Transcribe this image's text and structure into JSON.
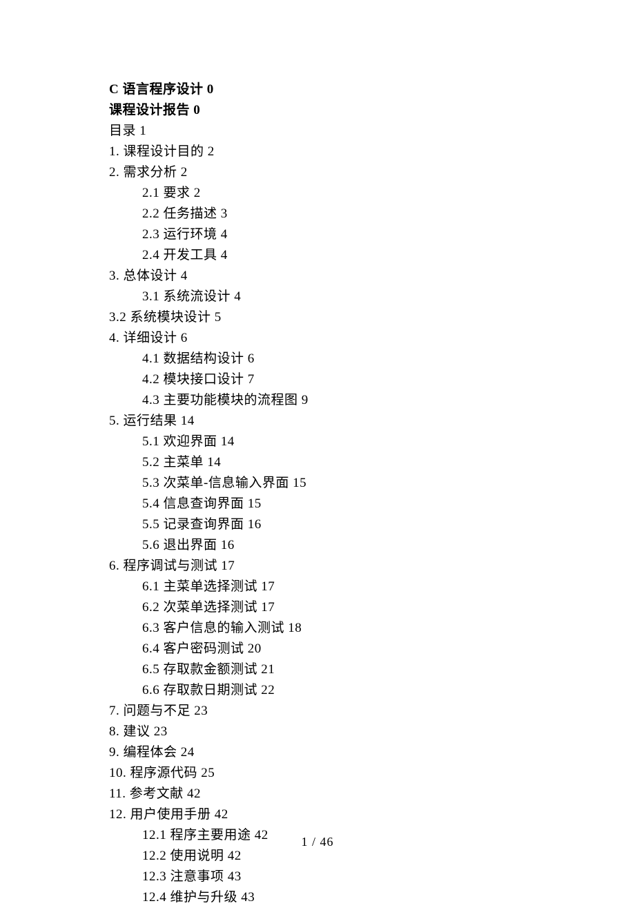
{
  "title1": "C 语言程序设计 0",
  "title2": "课程设计报告 0",
  "toc_label": "目录 1",
  "items": [
    {
      "text": "1. 课程设计目的 2",
      "indent": 0
    },
    {
      "text": "2. 需求分析 2",
      "indent": 0
    },
    {
      "text": "2.1 要求 2",
      "indent": 1
    },
    {
      "text": "2.2 任务描述 3",
      "indent": 1
    },
    {
      "text": "2.3 运行环境 4",
      "indent": 1
    },
    {
      "text": "2.4 开发工具 4",
      "indent": 1
    },
    {
      "text": "3. 总体设计 4",
      "indent": 0
    },
    {
      "text": "3.1 系统流设计 4",
      "indent": 1
    }
  ],
  "item_sys_module": "3.2 系统模块设计 5",
  "items2": [
    {
      "text": "4. 详细设计 6",
      "indent": 0
    },
    {
      "text": "4.1 数据结构设计 6",
      "indent": 1
    },
    {
      "text": "4.2 模块接口设计 7",
      "indent": 1
    },
    {
      "text": "4.3 主要功能模块的流程图 9",
      "indent": 1
    },
    {
      "text": "5. 运行结果 14",
      "indent": 0
    },
    {
      "text": "5.1 欢迎界面 14",
      "indent": 1
    },
    {
      "text": "5.2 主菜单 14",
      "indent": 1
    },
    {
      "text": "5.3 次菜单-信息输入界面 15",
      "indent": 1
    },
    {
      "text": "5.4 信息查询界面 15",
      "indent": 1
    },
    {
      "text": "5.5 记录查询界面 16",
      "indent": 1
    },
    {
      "text": "5.6 退出界面 16",
      "indent": 1
    },
    {
      "text": "6. 程序调试与测试 17",
      "indent": 0
    },
    {
      "text": "6.1 主菜单选择测试 17",
      "indent": 1
    },
    {
      "text": "6.2 次菜单选择测试 17",
      "indent": 1
    },
    {
      "text": "6.3 客户信息的输入测试 18",
      "indent": 1
    },
    {
      "text": "6.4 客户密码测试 20",
      "indent": 1
    },
    {
      "text": "6.5 存取款金额测试 21",
      "indent": 1
    },
    {
      "text": "6.6 存取款日期测试 22",
      "indent": 1
    },
    {
      "text": "7. 问题与不足 23",
      "indent": 0
    },
    {
      "text": "8. 建议 23",
      "indent": 0
    },
    {
      "text": "9. 编程体会 24",
      "indent": 0
    },
    {
      "text": "10. 程序源代码 25",
      "indent": 0
    },
    {
      "text": "11. 参考文献 42",
      "indent": 0
    },
    {
      "text": "12. 用户使用手册 42",
      "indent": 0
    },
    {
      "text": "12.1 程序主要用途 42",
      "indent": 1
    },
    {
      "text": "12.2 使用说明 42",
      "indent": 1
    },
    {
      "text": "12.3 注意事项 43",
      "indent": 1
    },
    {
      "text": "12.4 维护与升级 43",
      "indent": 1
    }
  ],
  "footer": "1 / 46"
}
